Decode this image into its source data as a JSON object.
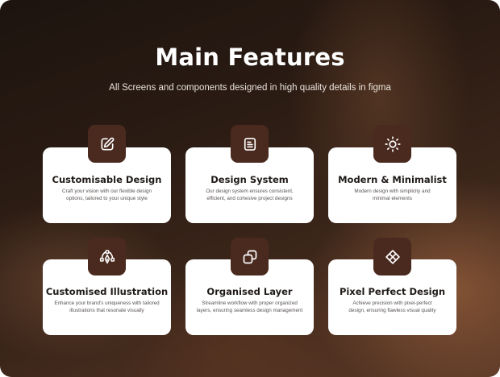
{
  "header": {
    "title": "Main Features",
    "subtitle": "All Screens and components designed in high quality details in figma"
  },
  "colors": {
    "icon_bg": "#4a2a1f",
    "card_bg": "#ffffff",
    "title_text": "#ffffff"
  },
  "features": [
    {
      "icon": "edit-icon",
      "title": "Customisable Design",
      "desc_line1": "Craft your vision with our flexible design",
      "desc_line2": "options, tailored to your unique style"
    },
    {
      "icon": "document-icon",
      "title": "Design System",
      "desc_line1": "Our design system ensures consistent,",
      "desc_line2": "efficient, and cohesive project designs"
    },
    {
      "icon": "sun-icon",
      "title": "Modern & Minimalist",
      "desc_line1": "Modern design with simplicity and",
      "desc_line2": "minimal elements"
    },
    {
      "icon": "vector-pen-icon",
      "title": "Customised Illustration",
      "desc_line1": "Enhance your brand's uniqueness with tailored",
      "desc_line2": "illustrations that resonate visually"
    },
    {
      "icon": "layers-icon",
      "title": "Organised Layer",
      "desc_line1": "Streamline workflow with proper organized",
      "desc_line2": "layers, ensuring seamless design management"
    },
    {
      "icon": "diamond-grid-icon",
      "title": "Pixel Perfect Design",
      "desc_line1": "Achieve precision with pixel-perfect",
      "desc_line2": "design, ensuring flawless visual quality"
    }
  ]
}
